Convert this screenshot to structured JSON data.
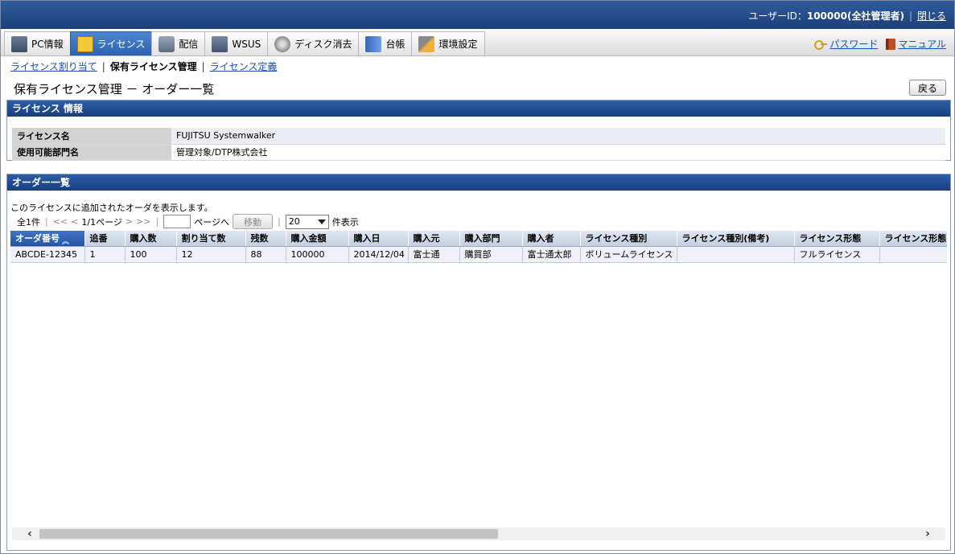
{
  "header": {
    "user_label": "ユーザーID：",
    "user_value": "100000(全社管理者)",
    "close_label": "閉じる"
  },
  "tabs": [
    {
      "label": "PC情報",
      "icon": "pc-icon"
    },
    {
      "label": "ライセンス",
      "icon": "license-icon"
    },
    {
      "label": "配信",
      "icon": "distribution-icon"
    },
    {
      "label": "WSUS",
      "icon": "wsus-icon"
    },
    {
      "label": "ディスク消去",
      "icon": "disk-erase-icon"
    },
    {
      "label": "台帳",
      "icon": "ledger-icon"
    },
    {
      "label": "環境設定",
      "icon": "settings-tools-icon"
    }
  ],
  "active_tab": "ライセンス",
  "top_links": {
    "password": "パスワード",
    "manual": "マニュアル"
  },
  "subnav": {
    "assign": "ライセンス割り当て",
    "manage": "保有ライセンス管理",
    "define": "ライセンス定義"
  },
  "page_title": "保有ライセンス管理 － オーダー一覧",
  "back_label": "戻る",
  "license_panel": {
    "title": "ライセンス 情報",
    "rows": [
      {
        "key": "ライセンス名",
        "value": "FUJITSU Systemwalker"
      },
      {
        "key": "使用可能部門名",
        "value": "管理対象/DTP株式会社"
      }
    ]
  },
  "order_panel": {
    "title": "オーダー一覧",
    "description": "このライセンスに追加されたオーダを表示します。",
    "pager": {
      "total": "全1件",
      "first": "<<",
      "prev": "<",
      "page_info": "1/1ページ",
      "next": ">",
      "last": ">>",
      "page_input": "",
      "goto_label": "ページへ",
      "move_button": "移動",
      "per_page": "20",
      "per_page_suffix": "件表示"
    },
    "columns": [
      "オーダ番号",
      "追番",
      "購入数",
      "割り当て数",
      "残数",
      "購入金額",
      "購入日",
      "購入元",
      "購入部門",
      "購入者",
      "ライセンス種別",
      "ライセンス種別(備考)",
      "ライセンス形態",
      "ライセンス形態"
    ],
    "rows": [
      [
        "ABCDE-12345",
        "1",
        "100",
        "12",
        "88",
        "100000",
        "2014/12/04",
        "富士通",
        "購買部",
        "富士通太郎",
        "ボリュームライセンス",
        "",
        "フルライセンス",
        ""
      ]
    ]
  },
  "colors": {
    "header_bg": "#1c3f79",
    "active_tab": "#2c63b1",
    "link": "#1a4fb0"
  }
}
